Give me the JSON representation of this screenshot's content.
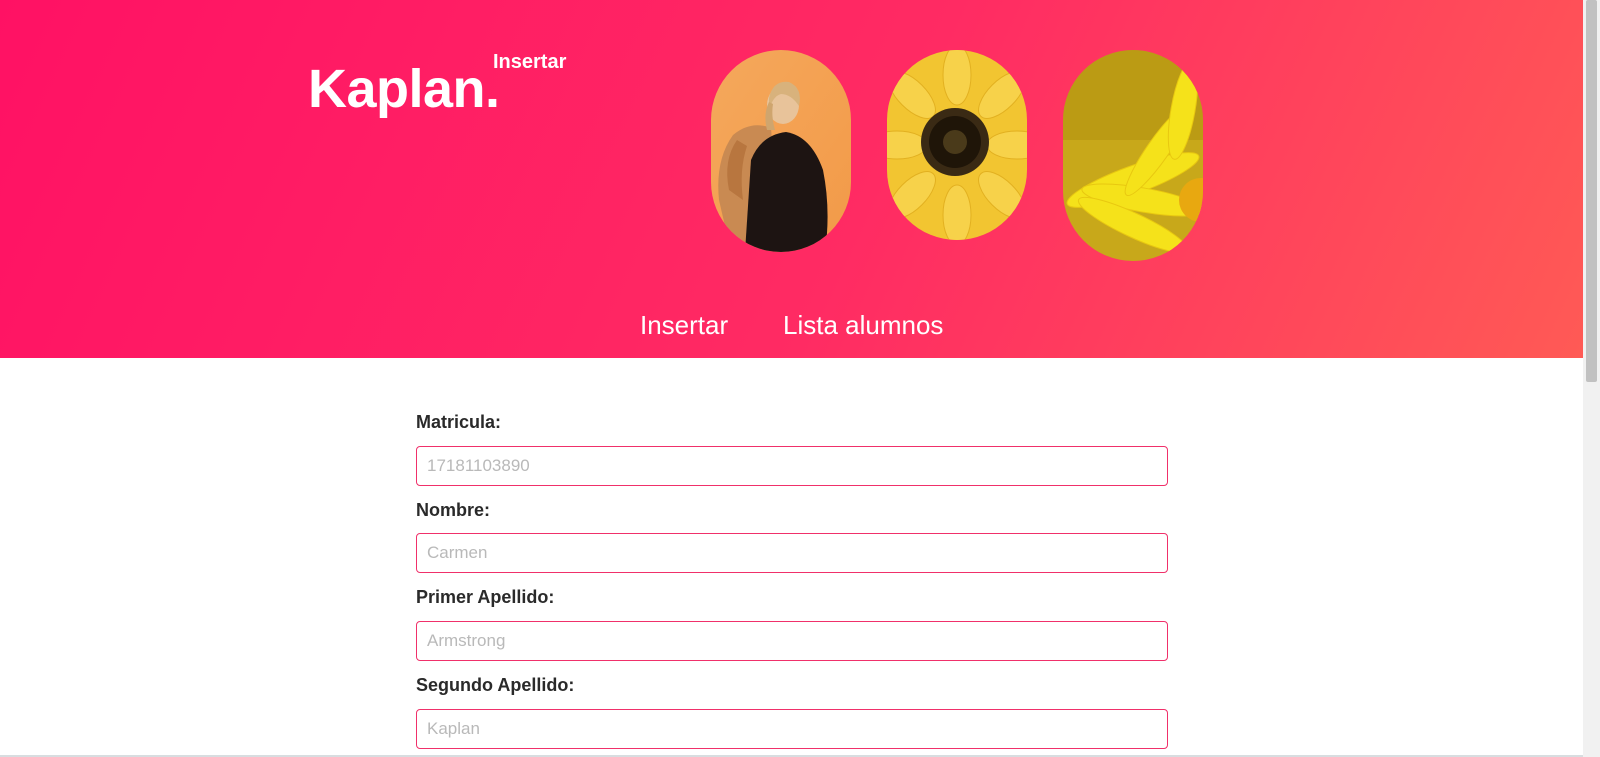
{
  "header": {
    "brand": "Kaplan.",
    "brand_sub": "Insertar",
    "images": [
      {
        "icon": "woman-orange-jacket-photo"
      },
      {
        "icon": "sunflower-photo"
      },
      {
        "icon": "yellow-daisy-closeup-photo"
      }
    ],
    "nav": [
      {
        "label": "Insertar"
      },
      {
        "label": "Lista alumnos"
      }
    ]
  },
  "form": {
    "fields": [
      {
        "label": "Matricula:",
        "placeholder": "17181103890",
        "value": ""
      },
      {
        "label": "Nombre:",
        "placeholder": "Carmen",
        "value": ""
      },
      {
        "label": "Primer Apellido:",
        "placeholder": "Armstrong",
        "value": ""
      },
      {
        "label": "Segundo Apellido:",
        "placeholder": "Kaplan",
        "value": ""
      }
    ]
  },
  "colors": {
    "hero_start": "#ff1164",
    "hero_end": "#ff5a55",
    "input_border": "#f0306a",
    "text": "#2a2a2a"
  }
}
